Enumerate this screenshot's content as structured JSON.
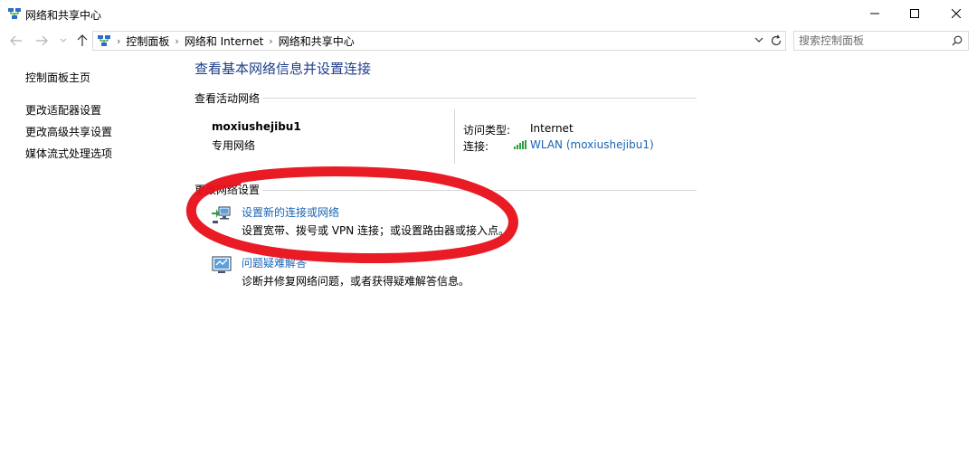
{
  "window": {
    "title": "网络和共享中心",
    "controls": {
      "minimize": "minimize-icon",
      "maximize": "maximize-icon",
      "close": "close-icon"
    }
  },
  "address_bar": {
    "breadcrumbs": [
      "控制面板",
      "网络和 Internet",
      "网络和共享中心"
    ],
    "search_placeholder": "搜索控制面板"
  },
  "sidebar": {
    "home": "控制面板主页",
    "items": [
      "更改适配器设置",
      "更改高级共享设置",
      "媒体流式处理选项"
    ]
  },
  "main": {
    "title": "查看基本网络信息并设置连接",
    "active_networks": {
      "heading": "查看活动网络",
      "network_name": "moxiushejibu1",
      "network_type": "专用网络",
      "access_type_label": "访问类型:",
      "access_type_value": "Internet",
      "connection_label": "连接:",
      "connection_value": "WLAN (moxiushejibu1)"
    },
    "change_settings": {
      "heading": "更改网络设置",
      "tasks": [
        {
          "link": "设置新的连接或网络",
          "desc": "设置宽带、拨号或 VPN 连接；或设置路由器或接入点。",
          "icon": "new-connection-icon"
        },
        {
          "link": "问题疑难解答",
          "desc": "诊断并修复网络问题，或者获得疑难解答信息。",
          "icon": "troubleshoot-icon"
        }
      ]
    }
  },
  "annotation": {
    "color": "#e8101a",
    "shape": "hand-drawn ellipse around 设置新的连接或网络"
  },
  "colors": {
    "heading_blue": "#1e3e8a",
    "link_blue": "#1a64b4",
    "signal_green": "#2e9e3e"
  }
}
